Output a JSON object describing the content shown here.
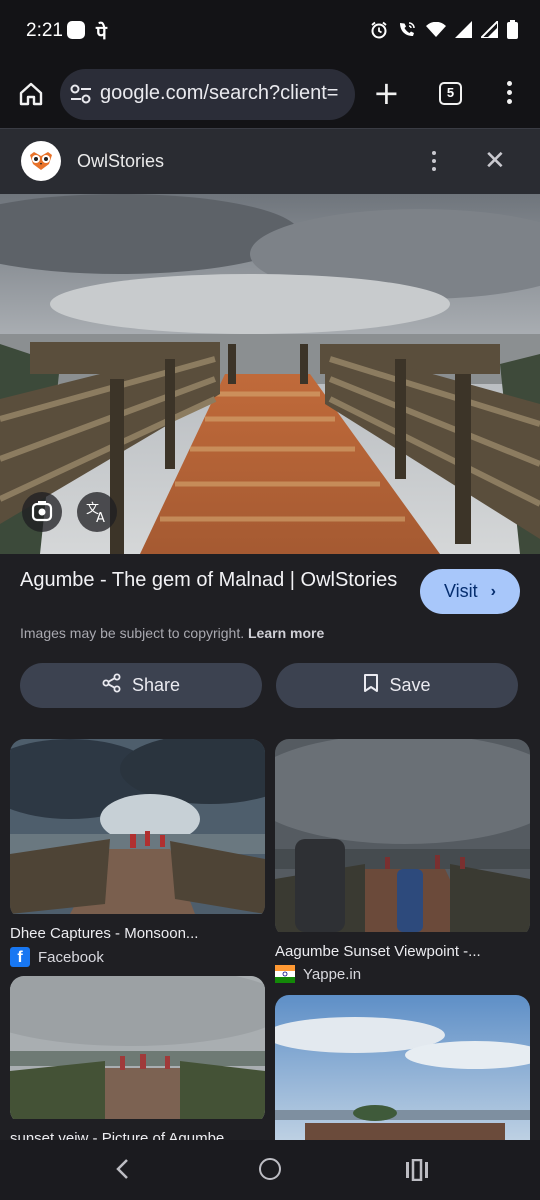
{
  "status": {
    "time": "2:21",
    "carrier_glyph": "पे",
    "icons": [
      "app-square-icon",
      "alarm-icon",
      "wifi-calling-icon",
      "wifi-icon",
      "signal-icon",
      "signal-icon",
      "battery-icon"
    ]
  },
  "browser": {
    "url": "google.com/search?client=",
    "tab_count": "5",
    "icons": [
      "home-icon",
      "site-settings-icon",
      "new-tab-icon",
      "tab-switcher-icon",
      "more-vert-icon"
    ]
  },
  "panel": {
    "site_name": "OwlStories",
    "icons": [
      "owl-logo-icon",
      "more-vert-icon",
      "close-icon"
    ]
  },
  "hero": {
    "icons": [
      "google-lens-icon",
      "translate-icon"
    ]
  },
  "result": {
    "title": "Agumbe - The gem of Malnad | OwlStories",
    "visit_label": "Visit",
    "copyright_text": "Images may be subject to copyright.",
    "learn_more": "Learn more",
    "share_label": "Share",
    "save_label": "Save"
  },
  "related": [
    {
      "title": "Dhee Captures - Monsoon...",
      "source": "Facebook",
      "source_icon": "facebook-icon"
    },
    {
      "title": "Aagumbe Sunset Viewpoint -...",
      "source": "Yappe.in",
      "source_icon": "india-flag-icon"
    },
    {
      "title": "sunset veiw - Picture of Agumbe...",
      "source": "",
      "source_icon": ""
    },
    {
      "title": "",
      "source": "",
      "source_icon": ""
    }
  ],
  "colors": {
    "background": "#1f1f23",
    "visit_button": "#a8c7fa",
    "action_button": "#3c4250",
    "facebook": "#1877f2"
  }
}
